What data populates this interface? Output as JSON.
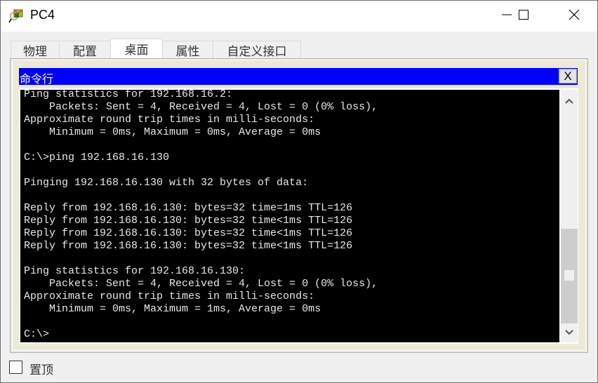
{
  "window": {
    "title": "PC4",
    "controls": {
      "minimize": "minimize",
      "maximize": "maximize",
      "close": "close"
    }
  },
  "tabs": [
    {
      "label": "物理",
      "active": false
    },
    {
      "label": "配置",
      "active": false
    },
    {
      "label": "桌面",
      "active": true
    },
    {
      "label": "属性",
      "active": false
    },
    {
      "label": "自定义接口",
      "active": false
    }
  ],
  "command_prompt": {
    "title": "命令行",
    "close_label": "X",
    "output": "Ping statistics for 192.168.16.2:\n    Packets: Sent = 4, Received = 4, Lost = 0 (0% loss),\nApproximate round trip times in milli-seconds:\n    Minimum = 0ms, Maximum = 0ms, Average = 0ms\n\nC:\\>ping 192.168.16.130\n\nPinging 192.168.16.130 with 32 bytes of data:\n\nReply from 192.168.16.130: bytes=32 time=1ms TTL=126\nReply from 192.168.16.130: bytes=32 time<1ms TTL=126\nReply from 192.168.16.130: bytes=32 time<1ms TTL=126\nReply from 192.168.16.130: bytes=32 time<1ms TTL=126\n\nPing statistics for 192.168.16.130:\n    Packets: Sent = 4, Received = 4, Lost = 0 (0% loss),\nApproximate round trip times in milli-seconds:\n    Minimum = 0ms, Maximum = 1ms, Average = 0ms\n\nC:\\>"
  },
  "footer": {
    "always_on_top_label": "置顶",
    "always_on_top_checked": false
  },
  "colors": {
    "header_blue": "#0000ff",
    "terminal_bg": "#000000",
    "terminal_fg": "#e8e8e8",
    "panel_bg": "#ece9d8"
  }
}
